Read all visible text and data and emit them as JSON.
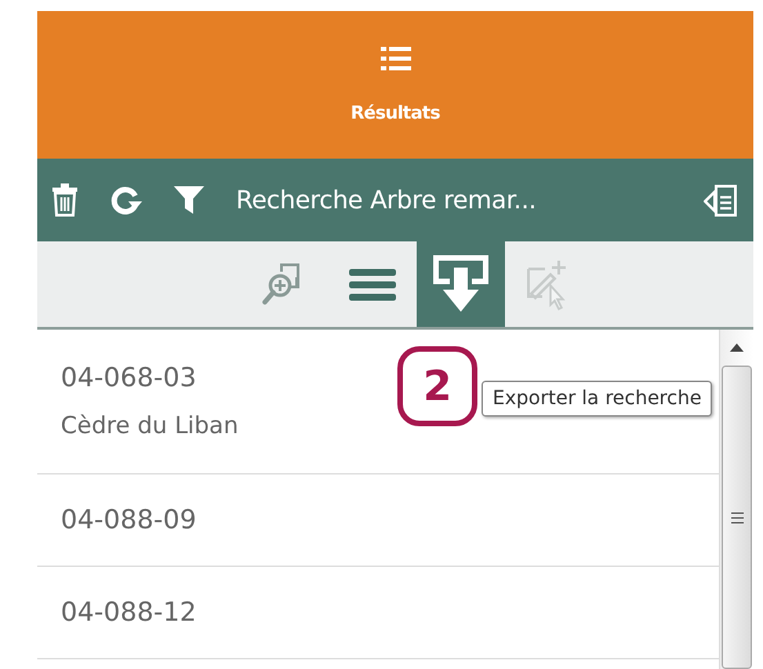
{
  "header": {
    "title": "Résultats"
  },
  "toolbar": {
    "search_title": "Recherche Arbre remar..."
  },
  "tools": [
    {
      "kind": "zoom",
      "selected": false,
      "disabled": false
    },
    {
      "kind": "list",
      "selected": false,
      "disabled": false
    },
    {
      "kind": "export",
      "selected": true,
      "disabled": false
    },
    {
      "kind": "edit",
      "selected": false,
      "disabled": true
    }
  ],
  "tooltip": "Exporter la recherche",
  "callout": "2",
  "results": [
    {
      "code": "04-068-03",
      "name": "Cèdre du Liban"
    },
    {
      "code": "04-088-09"
    },
    {
      "code": "04-088-12"
    }
  ]
}
